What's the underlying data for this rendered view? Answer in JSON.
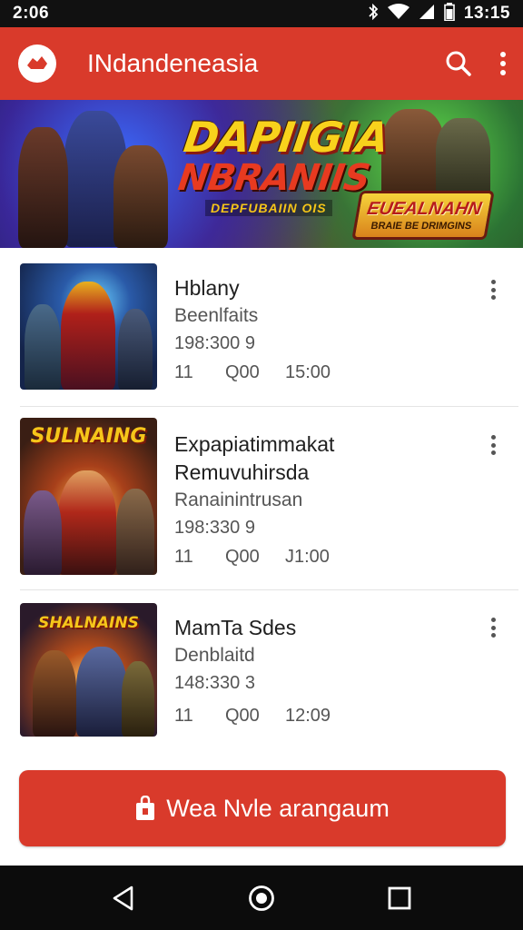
{
  "status_bar": {
    "time_left": "2:06",
    "time_right": "13:15",
    "icons": [
      "bluetooth-icon",
      "wifi-icon",
      "signal-icon",
      "battery-icon"
    ]
  },
  "app_bar": {
    "title": "INdandeneasia",
    "logo_icon": "app-logo-icon",
    "actions": [
      "search-icon",
      "more-vert-icon"
    ],
    "color": "#d93a2b"
  },
  "banner": {
    "title_line1": "DAPIIGIA",
    "title_line2": "NBRANIIS",
    "subtitle": "DEPFUBAIIN OIS",
    "badge_title": "EUEALNAHN",
    "badge_sub": "BRAIE BE DRIMGINS"
  },
  "games": [
    {
      "name": "Hblany",
      "sub": "Beenlfaits",
      "extra": "",
      "code": "198:300 9",
      "stat1": "11",
      "stat2": "Q00",
      "stat3": "15:00"
    },
    {
      "name": "Expapiatimmakat",
      "sub": "Remuvuhirsda",
      "extra": "Ranainintrusan",
      "code": "198:330 9",
      "stat1": "11",
      "stat2": "Q00",
      "stat3": "J1:00",
      "thumb_logo": "SULNAING"
    },
    {
      "name": "MamTa Sdes",
      "sub": "Denblaitd",
      "extra": "",
      "code": "148:330 3",
      "stat1": "11",
      "stat2": "Q00",
      "stat3": "12:09",
      "thumb_logo": "SHALNAINS"
    }
  ],
  "cta": {
    "label": "Wea Nvle arangaum",
    "icon": "shopping-bag-icon"
  },
  "nav_bar": {
    "buttons": [
      "back-icon",
      "home-icon",
      "recents-icon"
    ]
  }
}
